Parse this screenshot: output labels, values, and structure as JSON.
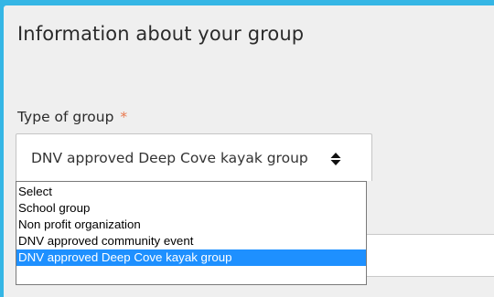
{
  "section": {
    "title": "Information about your group"
  },
  "group_type": {
    "label": "Type of group",
    "required_mark": "*",
    "selected_value": "DNV approved Deep Cove kayak group",
    "options": [
      "Select",
      "School group",
      "Non profit organization",
      "DNV approved community event",
      "DNV approved Deep Cove kayak group"
    ],
    "selected_index": 4
  },
  "colors": {
    "page_background": "#35b6e5",
    "panel_background": "#efefef",
    "required_mark": "#e9774d",
    "option_highlight": "#1e90ff"
  },
  "icons": {
    "select_arrow": "up-down-arrows-icon"
  }
}
